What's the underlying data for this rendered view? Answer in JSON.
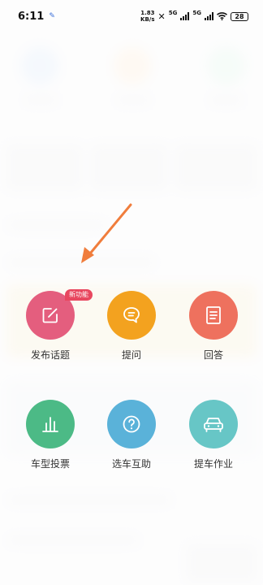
{
  "status_bar": {
    "time": "6:11",
    "speed_value": "1.83",
    "speed_unit": "KB/s",
    "net1": "5G",
    "net2": "5G",
    "battery": "28"
  },
  "actions": [
    {
      "label": "发布话题",
      "icon": "edit-icon",
      "color": "#e45e7e",
      "badge": "新功能"
    },
    {
      "label": "提问",
      "icon": "chat-bubble-icon",
      "color": "#f3a21f"
    },
    {
      "label": "回答",
      "icon": "document-icon",
      "color": "#ee715e"
    },
    {
      "label": "车型投票",
      "icon": "bar-chart-icon",
      "color": "#4cba86"
    },
    {
      "label": "选车互助",
      "icon": "question-icon",
      "color": "#5ab2d9"
    },
    {
      "label": "提车作业",
      "icon": "car-icon",
      "color": "#67c6c6"
    }
  ],
  "colors": {
    "arrow": "#f07d3c",
    "background": "#f4f4f5"
  }
}
